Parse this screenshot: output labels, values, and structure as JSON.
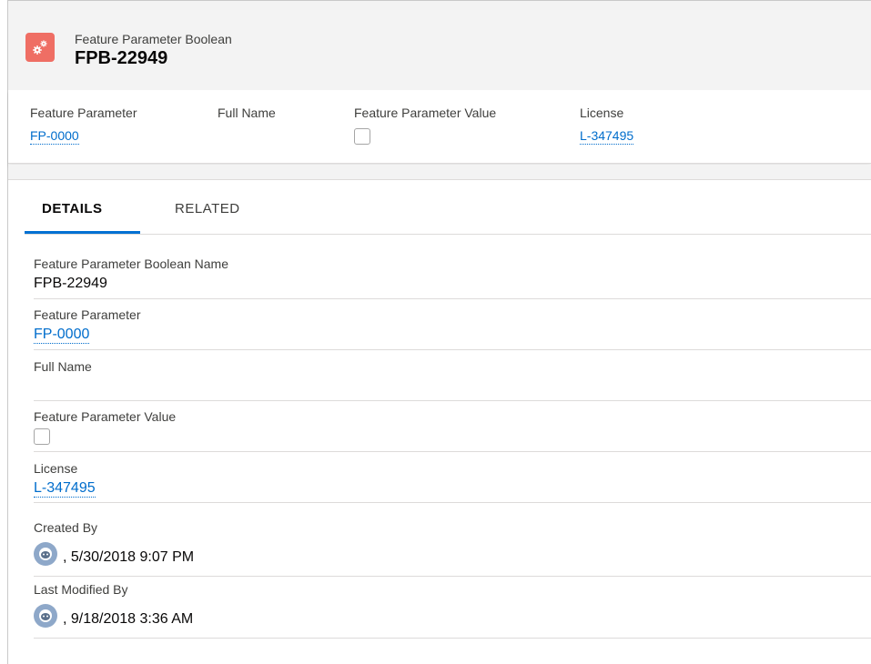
{
  "header": {
    "object_type": "Feature Parameter Boolean",
    "record_name": "FPB-22949",
    "icon": "gears-icon",
    "icon_color": "#ef6e64"
  },
  "highlights": [
    {
      "label": "Feature Parameter",
      "value": "FP-0000",
      "kind": "link"
    },
    {
      "label": "Full Name",
      "value": "",
      "kind": "text"
    },
    {
      "label": "Feature Parameter Value",
      "value": false,
      "kind": "checkbox"
    },
    {
      "label": "License",
      "value": "L-347495",
      "kind": "link"
    }
  ],
  "tabs": [
    {
      "label": "DETAILS",
      "active": true
    },
    {
      "label": "RELATED",
      "active": false
    }
  ],
  "details": {
    "name_label": "Feature Parameter Boolean Name",
    "name_value": "FPB-22949",
    "fp_label": "Feature Parameter",
    "fp_value": "FP-0000",
    "fullname_label": "Full Name",
    "fullname_value": "",
    "fpv_label": "Feature Parameter Value",
    "fpv_checked": false,
    "license_label": "License",
    "license_value": "L-347495",
    "created_label": "Created By",
    "created_value": ", 5/30/2018 9:07 PM",
    "modified_label": "Last Modified By",
    "modified_value": ", 9/18/2018 3:36 AM"
  },
  "colors": {
    "link": "#006dcc",
    "tab_active": "#0070d2",
    "header_bg": "#f3f3f3"
  }
}
